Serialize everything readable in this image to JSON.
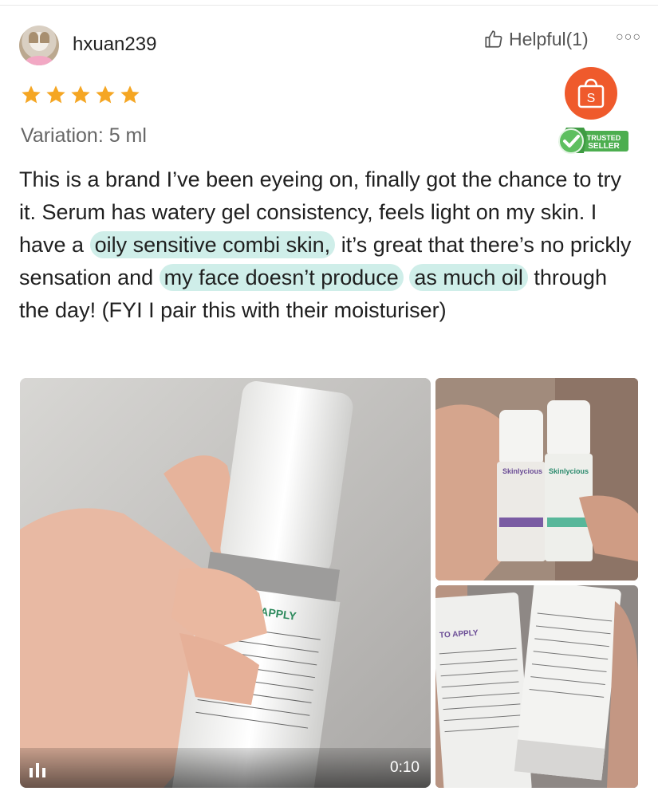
{
  "review": {
    "username": "hxuan239",
    "helpful_label": "Helpful(1)",
    "more_icon": "more-icon",
    "rating": 5,
    "variation": "Variation: 5 ml",
    "badge_letter": "S",
    "trusted_line1": "TRUSTED",
    "trusted_line2": "SELLER",
    "text_parts": {
      "p1": "This is a brand I’ve been eyeing on, finally got the chance to try it. Serum has watery gel consistency, feels light on my skin. I have a ",
      "h1": "oily sensitive combi skin,",
      "p2": " it’s great that there’s no prickly sensation and ",
      "h2a": "my face doesn’t produce",
      "h2b": "as much oil",
      "p3": " through the day! (FYI I pair this with their moisturiser)"
    },
    "video_duration": "0:10"
  },
  "colors": {
    "star": "#f5a623",
    "highlight": "#cfeee9",
    "shop_orange": "#ef5a2c",
    "trusted_green": "#4cae4f"
  }
}
